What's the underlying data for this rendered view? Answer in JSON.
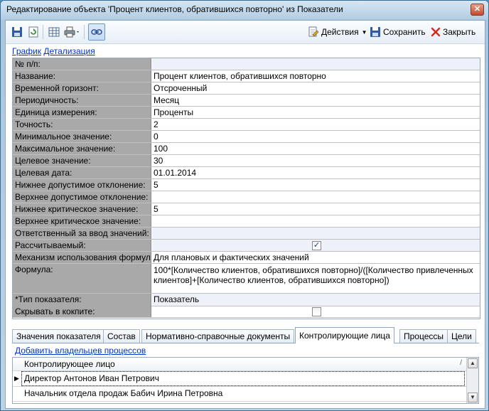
{
  "window": {
    "title": "Редактирование объекта 'Процент клиентов, обратившихся повторно' из Показатели",
    "close_glyph": "✕"
  },
  "toolbar": {
    "actions_label": "Действия",
    "save_label": "Сохранить",
    "close_label": "Закрыть"
  },
  "links": {
    "chart": "График",
    "detail": "Детализация"
  },
  "fields": [
    {
      "label": "№ п/п:",
      "value": ""
    },
    {
      "label": "Название:",
      "value": "Процент клиентов, обратившихся повторно"
    },
    {
      "label": "Временной горизонт:",
      "value": "Отсроченный"
    },
    {
      "label": "Периодичность:",
      "value": "Месяц"
    },
    {
      "label": "Единица измерения:",
      "value": "Проценты"
    },
    {
      "label": "Точность:",
      "value": "2"
    },
    {
      "label": "Минимальное значение:",
      "value": "0"
    },
    {
      "label": "Максимальное значение:",
      "value": "100"
    },
    {
      "label": "Целевое значение:",
      "value": "30"
    },
    {
      "label": "Целевая дата:",
      "value": "01.01.2014"
    },
    {
      "label": "Нижнее допустимое отклонение:",
      "value": "5"
    },
    {
      "label": "Верхнее допустимое отклонение:",
      "value": ""
    },
    {
      "label": "Нижнее критическое значение:",
      "value": "5"
    },
    {
      "label": "Верхнее критическое значение:",
      "value": ""
    },
    {
      "label": "Ответственный за ввод значений:",
      "value": ""
    },
    {
      "label": "Рассчитываемый:",
      "checked": true
    },
    {
      "label": "Механизм использования формулы:",
      "value": "Для плановых и фактических значений"
    },
    {
      "label": "Формула:",
      "value": "100*[Количество клиентов, обратившихся повторно]/([Количество привлеченных клиентов]+[Количество клиентов, обратившихся повторно])"
    },
    {
      "label": "*Тип показателя:",
      "value": "Показатель"
    },
    {
      "label": "Скрывать в кокпите:",
      "checked": false
    }
  ],
  "tabs": [
    {
      "label": "Значения показателя"
    },
    {
      "label": "Состав"
    },
    {
      "label": "Нормативно-справочные документы"
    },
    {
      "label": "Контролирующие лица",
      "active": true
    },
    {
      "label": "Процессы"
    },
    {
      "label": "Цели"
    }
  ],
  "panel": {
    "add_link": "Добавить владельцев процессов",
    "column_header": "Контролирующее лицо",
    "rows": [
      "Директор Антонов Иван Петрович",
      "Начальник отдела продаж Бабич Ирина Петровна"
    ]
  },
  "colors": {
    "label_bg": "#a9a9a9",
    "value_shade": "#eef0fa",
    "link": "#0033cc"
  }
}
